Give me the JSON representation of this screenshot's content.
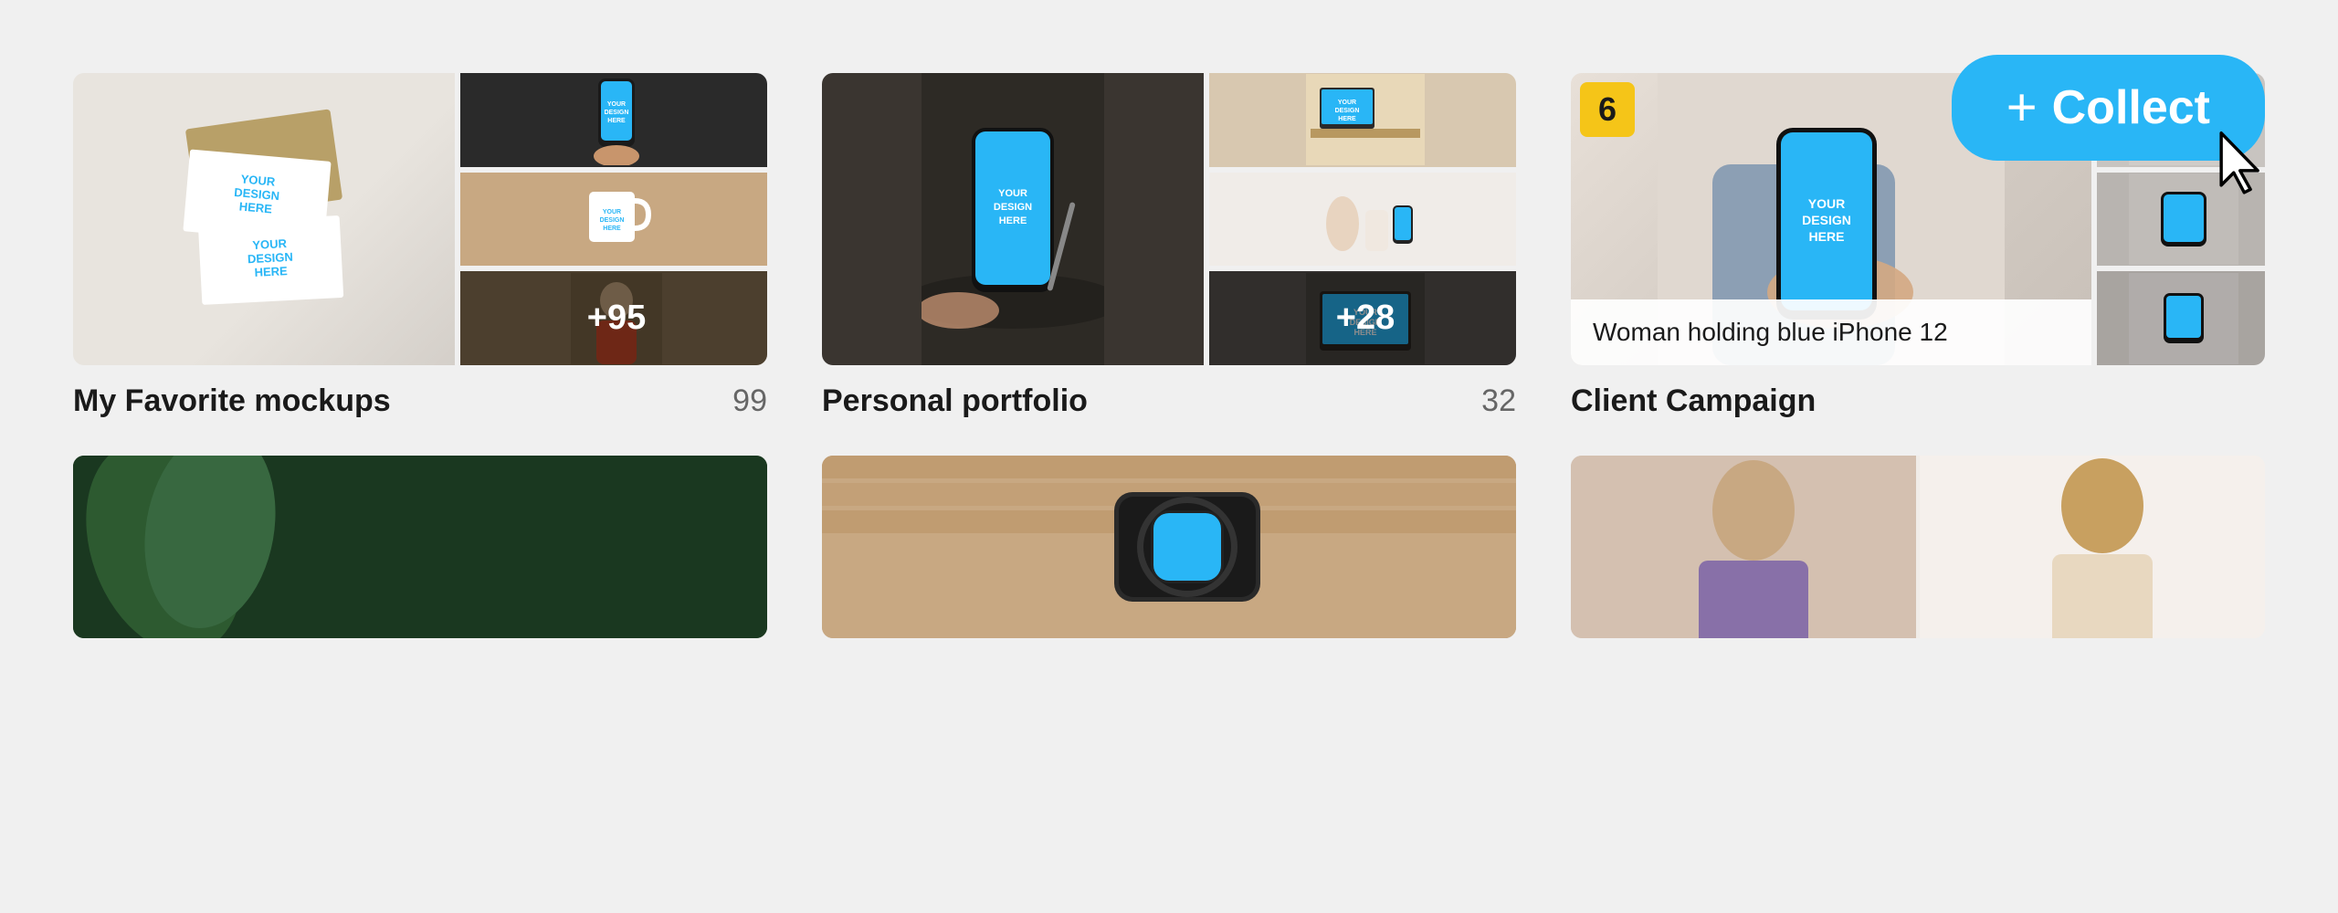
{
  "collect_button": {
    "label": "Collect",
    "plus": "+"
  },
  "collections": [
    {
      "name": "My Favorite mockups",
      "count": "99",
      "images": {
        "main": "business-cards",
        "sm1": "phone-hand",
        "sm2": "mug",
        "sm3": "person-plus95"
      }
    },
    {
      "name": "Personal portfolio",
      "count": "32",
      "images": {
        "main": "phone-desk",
        "sm1": "room",
        "sm2": "decor",
        "sm3": "laptop-plus28"
      }
    },
    {
      "name": "Client Campaign",
      "count": "",
      "badge": "6",
      "images": {
        "main": "woman-phone",
        "caption": "Woman holding blue iPhone 12",
        "sm1": "gray1",
        "sm2": "gray2",
        "sm3": "gray3"
      }
    }
  ],
  "row2": [
    {
      "type": "dark-green"
    },
    {
      "type": "wood-watch"
    },
    {
      "type": "desk-woman"
    }
  ],
  "design_text": "YOUR\nDESIGN\nHERE",
  "count_overlays": {
    "fav_sm3": "+95",
    "portfolio_sm3": "+28"
  },
  "cursor": "pointer-hand"
}
